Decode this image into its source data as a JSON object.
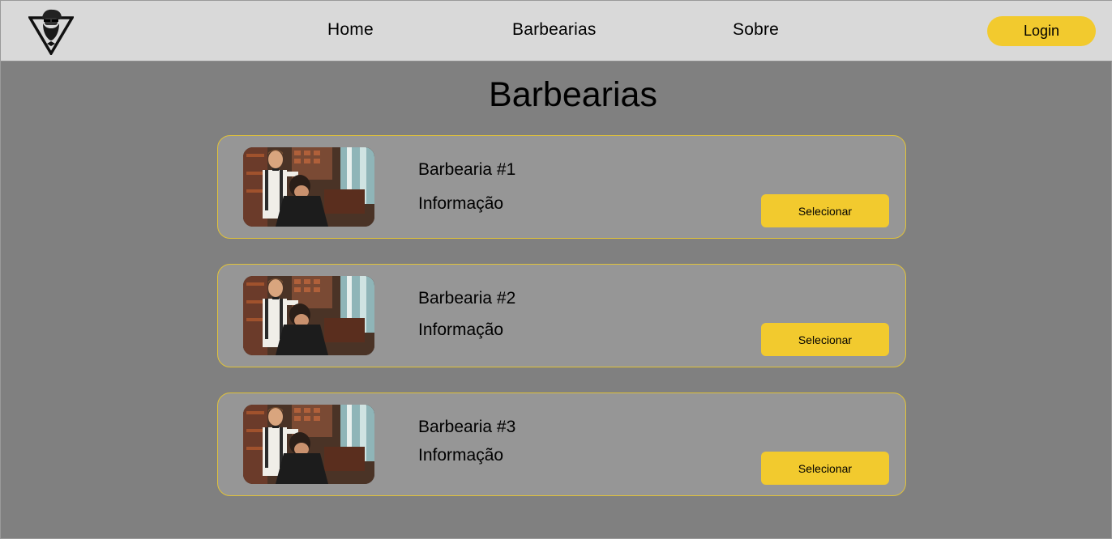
{
  "header": {
    "logo_icon": "bearded-man-triangle-logo-icon",
    "nav": [
      {
        "label": "Home"
      },
      {
        "label": "Barbearias"
      },
      {
        "label": "Sobre"
      }
    ],
    "login_label": "Login"
  },
  "main": {
    "title": "Barbearias",
    "cards": [
      {
        "name": "Barbearia #1",
        "info": "Informação",
        "button_label": "Selecionar",
        "image_icon": "barber-cutting-hair-photo"
      },
      {
        "name": "Barbearia #2",
        "info": "Informação",
        "button_label": "Selecionar",
        "image_icon": "barber-cutting-hair-photo"
      },
      {
        "name": "Barbearia #3",
        "info": "Informação",
        "button_label": "Selecionar",
        "image_icon": "barber-cutting-hair-photo"
      }
    ]
  },
  "colors": {
    "accent": "#f2ca2e",
    "header_bg": "#d9d9d9",
    "page_bg": "#808080",
    "card_bg": "#969696",
    "card_border": "#e0c23a"
  }
}
